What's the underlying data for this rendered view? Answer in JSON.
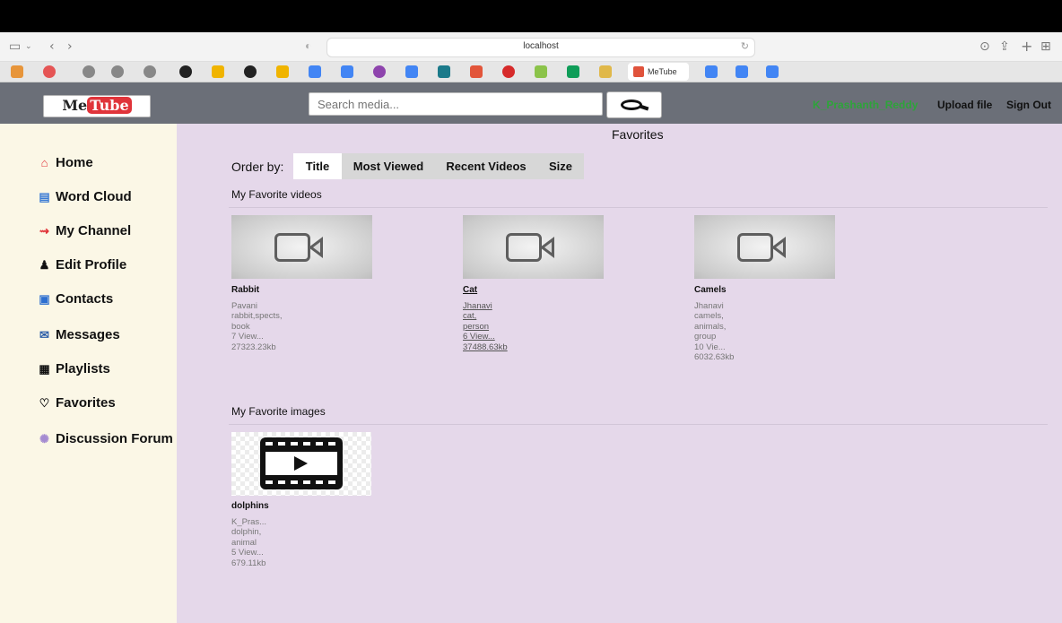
{
  "browser": {
    "url": "localhost",
    "active_tab_label": "MeTube"
  },
  "header": {
    "logo_prefix": "Me",
    "logo_suffix": "Tube",
    "search_placeholder": "Search media...",
    "username": "K_Prashanth_Reddy",
    "upload_label": "Upload file",
    "signout_label": "Sign Out"
  },
  "sidebar": {
    "items": [
      {
        "label": "Home",
        "icon": "house-icon"
      },
      {
        "label": "Word Cloud",
        "icon": "word-cloud-icon"
      },
      {
        "label": "My Channel",
        "icon": "channel-icon"
      },
      {
        "label": "Edit Profile",
        "icon": "user-edit-icon"
      },
      {
        "label": "Contacts",
        "icon": "contacts-icon"
      },
      {
        "label": "Messages",
        "icon": "messages-icon"
      },
      {
        "label": "Playlists",
        "icon": "playlist-icon"
      },
      {
        "label": "Favorites",
        "icon": "heart-icon"
      },
      {
        "label": "Discussion Forum",
        "icon": "forum-icon"
      }
    ]
  },
  "main": {
    "title": "Favorites",
    "order_by_label": "Order by:",
    "sort_options": [
      "Title",
      "Most Viewed",
      "Recent Videos",
      "Size"
    ],
    "active_sort": "Title",
    "videos_heading": "My Favorite videos",
    "videos": [
      {
        "title": "Rabbit",
        "owner": "Pavani",
        "tags1": "rabbit,spects,",
        "tags2": "book",
        "views": "7 View...",
        "size": "27323.23kb"
      },
      {
        "title": "Cat",
        "owner": "Jhanavi",
        "tags1": "cat,",
        "tags2": "person",
        "views": "6 View...",
        "size": "37488.63kb"
      },
      {
        "title": "Camels",
        "owner": "Jhanavi",
        "tags1": "camels,",
        "tags2": "animals,",
        "tags3": "group",
        "views": "10 Vie...",
        "size": "6032.63kb"
      }
    ],
    "images_heading": "My Favorite images",
    "images": [
      {
        "title": "dolphins",
        "owner": "K_Pras...",
        "tags1": "dolphin,",
        "tags2": "animal",
        "views": "5 View...",
        "size": "679.11kb"
      }
    ]
  },
  "colors": {
    "navbar": "#6b6f78",
    "sidebar_bg": "#fbf7e6",
    "main_bg": "#e5d8ea",
    "username": "#2ea43a",
    "logo_accent": "#e0343a"
  }
}
